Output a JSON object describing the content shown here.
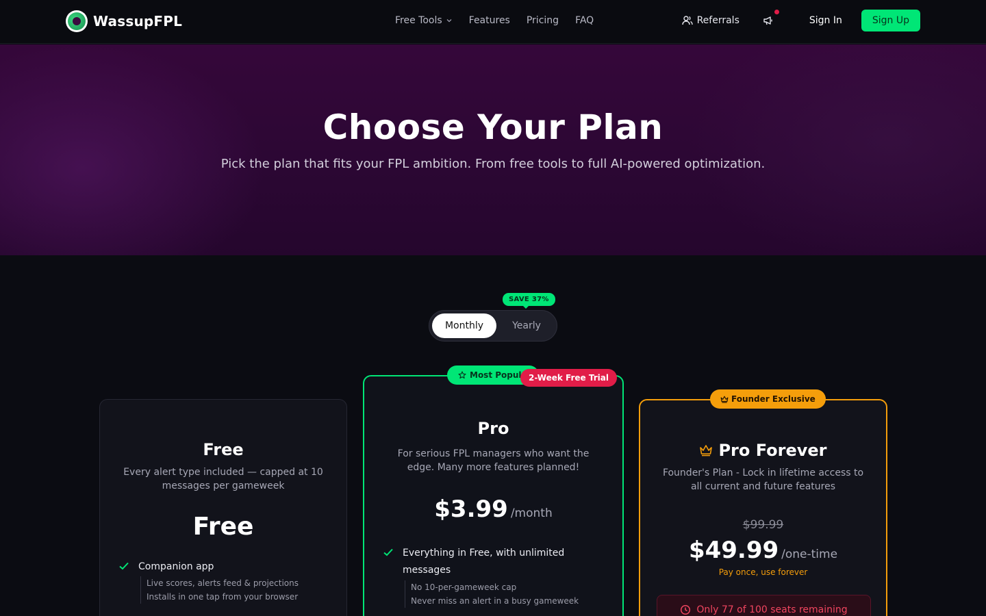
{
  "nav": {
    "brand": "WassupFPL",
    "links": [
      {
        "label": "Free Tools",
        "has_dropdown": true
      },
      {
        "label": "Features"
      },
      {
        "label": "Pricing"
      },
      {
        "label": "FAQ"
      }
    ],
    "referrals": "Referrals",
    "sign_in": "Sign In",
    "sign_up": "Sign Up"
  },
  "hero": {
    "title": "Choose Your Plan",
    "subtitle": "Pick the plan that fits your FPL ambition. From free tools to full AI-powered optimization."
  },
  "billing_toggle": {
    "monthly": "Monthly",
    "yearly": "Yearly",
    "selected": "Monthly",
    "save_badge": "SAVE 37%"
  },
  "plans": {
    "free": {
      "title": "Free",
      "description": "Every alert type included — capped at 10 messages per gameweek",
      "price": "Free",
      "features": [
        {
          "label": "Companion app",
          "details": [
            "Live scores, alerts feed & projections",
            "Installs in one tap from your browser"
          ]
        }
      ]
    },
    "pro": {
      "badge": "Most Popul",
      "trial_badge": "2-Week Free Trial",
      "title": "Pro",
      "description": "For serious FPL managers who want the edge. Many more features planned!",
      "price": "$3.99",
      "price_unit": "/month",
      "features": [
        {
          "label": "Everything in Free, with unlimited messages",
          "details": [
            "No 10-per-gameweek cap",
            "Never miss an alert in a busy gameweek"
          ]
        }
      ]
    },
    "forever": {
      "badge": "Founder Exclusive",
      "title": "Pro Forever",
      "description": "Founder's Plan - Lock in lifetime access to all current and future features",
      "original_price": "$99.99",
      "price": "$49.99",
      "price_unit": "/one-time",
      "note": "Pay once, use forever",
      "seats": "Only 77 of 100 seats remaining"
    }
  },
  "colors": {
    "accent_green": "#00e676",
    "accent_red": "#e11d48",
    "accent_orange": "#f59e0b",
    "background": "#0b0c12"
  }
}
